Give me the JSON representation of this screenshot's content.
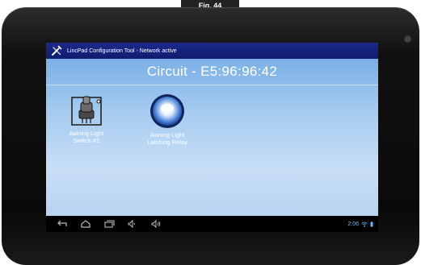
{
  "figure": {
    "tab_label": "Fig. 44"
  },
  "app": {
    "title": "LincPad Configuration Tool - Network active",
    "icon": "tools-icon"
  },
  "circuit": {
    "title": "Circuit - E5:96:96:42"
  },
  "devices": [
    {
      "label_line1": "Awning Light",
      "label_line2": "Switch #1",
      "icon": "switch-device-icon"
    },
    {
      "label_line1": "Awning Light",
      "label_line2": "Latching Relay",
      "icon": "light-device-icon"
    }
  ],
  "navbar": {
    "buttons": [
      "back-icon",
      "home-icon",
      "recent-apps-icon",
      "volume-down-icon",
      "volume-up-icon"
    ],
    "clock": "2:06",
    "status_icons": [
      "wifi-icon",
      "battery-icon"
    ]
  },
  "colors": {
    "titlebar": "#1b2a8a",
    "content_bg": "#a7ccf0",
    "clock": "#5fb9ff"
  }
}
